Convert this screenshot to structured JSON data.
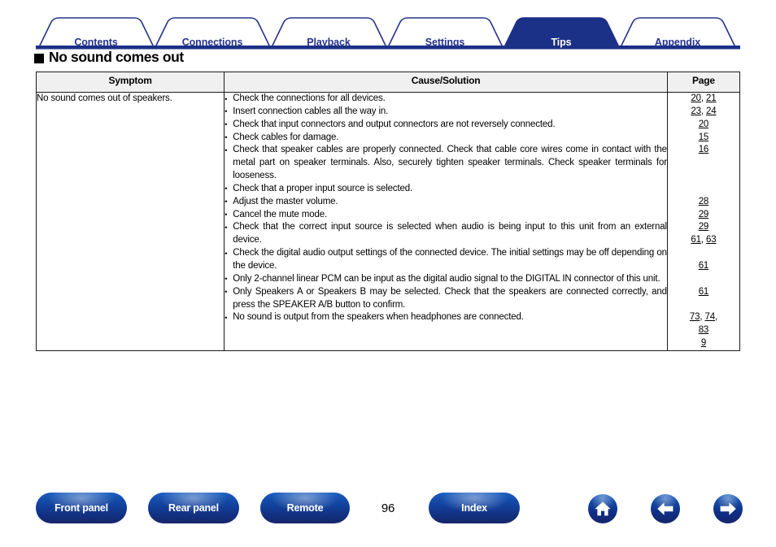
{
  "tabs": [
    {
      "label": "Contents",
      "active": false
    },
    {
      "label": "Connections",
      "active": false
    },
    {
      "label": "Playback",
      "active": false
    },
    {
      "label": "Settings",
      "active": false
    },
    {
      "label": "Tips",
      "active": true
    },
    {
      "label": "Appendix",
      "active": false
    }
  ],
  "heading": {
    "bullet": "filled-square",
    "text": "No sound comes out"
  },
  "table": {
    "headers": {
      "symptom": "Symptom",
      "cause": "Cause/Solution",
      "page": "Page"
    },
    "rows": [
      {
        "symptom": "No sound comes out of speakers.",
        "causes": [
          "Check the connections for all devices.",
          "Insert connection cables all the way in.",
          "Check that input connectors and output connectors are not reversely connected.",
          "Check cables for damage.",
          "Check that speaker cables are properly connected. Check that cable core wires come in contact with the metal part on speaker terminals. Also, securely tighten speaker terminals. Check speaker terminals for looseness.",
          "Check that a proper input source is selected.",
          "Adjust the master volume.",
          "Cancel the mute mode.",
          "Check that the correct input source is selected when audio is being input to this unit from an external device.",
          "Check the digital audio output settings of the connected device. The initial settings may be off depending on the device.",
          "Only 2-channel linear PCM can be input as the digital audio signal to the DIGITAL IN connector of this unit.",
          "Only Speakers A or Speakers B may be selected. Check that the speakers are connected correctly, and press the SPEAKER A/B button to confirm.",
          "No sound is output from the speakers when headphones are connected."
        ],
        "pages": [
          {
            "refs": [
              "20",
              "21"
            ],
            "blank_after": 0
          },
          {
            "refs": [
              "23",
              "24"
            ],
            "blank_after": 0
          },
          {
            "refs": [
              "20"
            ],
            "blank_after": 0
          },
          {
            "refs": [
              "15"
            ],
            "blank_after": 0
          },
          {
            "refs": [
              "16"
            ],
            "blank_after": 3
          },
          {
            "refs": [
              "28"
            ],
            "blank_after": 0
          },
          {
            "refs": [
              "29"
            ],
            "blank_after": 0
          },
          {
            "refs": [
              "29"
            ],
            "blank_after": 0
          },
          {
            "refs": [
              "61",
              "63"
            ],
            "blank_after": 1
          },
          {
            "refs": [
              "61"
            ],
            "blank_after": 1
          },
          {
            "refs": [
              "61"
            ],
            "blank_after": 1
          },
          {
            "refs": [
              "73",
              "74",
              "83"
            ],
            "blank_after": 0
          },
          {
            "refs": [
              "9"
            ],
            "blank_after": 0
          }
        ]
      }
    ]
  },
  "footer": {
    "buttons": [
      {
        "id": "front",
        "label": "Front panel"
      },
      {
        "id": "rear",
        "label": "Rear panel"
      },
      {
        "id": "remote",
        "label": "Remote"
      },
      {
        "id": "index",
        "label": "Index"
      }
    ],
    "page_number": "96",
    "icons": [
      {
        "id": "home",
        "name": "home-icon"
      },
      {
        "id": "back",
        "name": "arrow-left-icon"
      },
      {
        "id": "fwd",
        "name": "arrow-right-icon"
      }
    ]
  },
  "colors": {
    "navy": "#26338b",
    "tab_active_bg": "#1b3087",
    "header_bg": "#f0f0f0",
    "button_blue": "#14469f",
    "text": "#000000"
  }
}
